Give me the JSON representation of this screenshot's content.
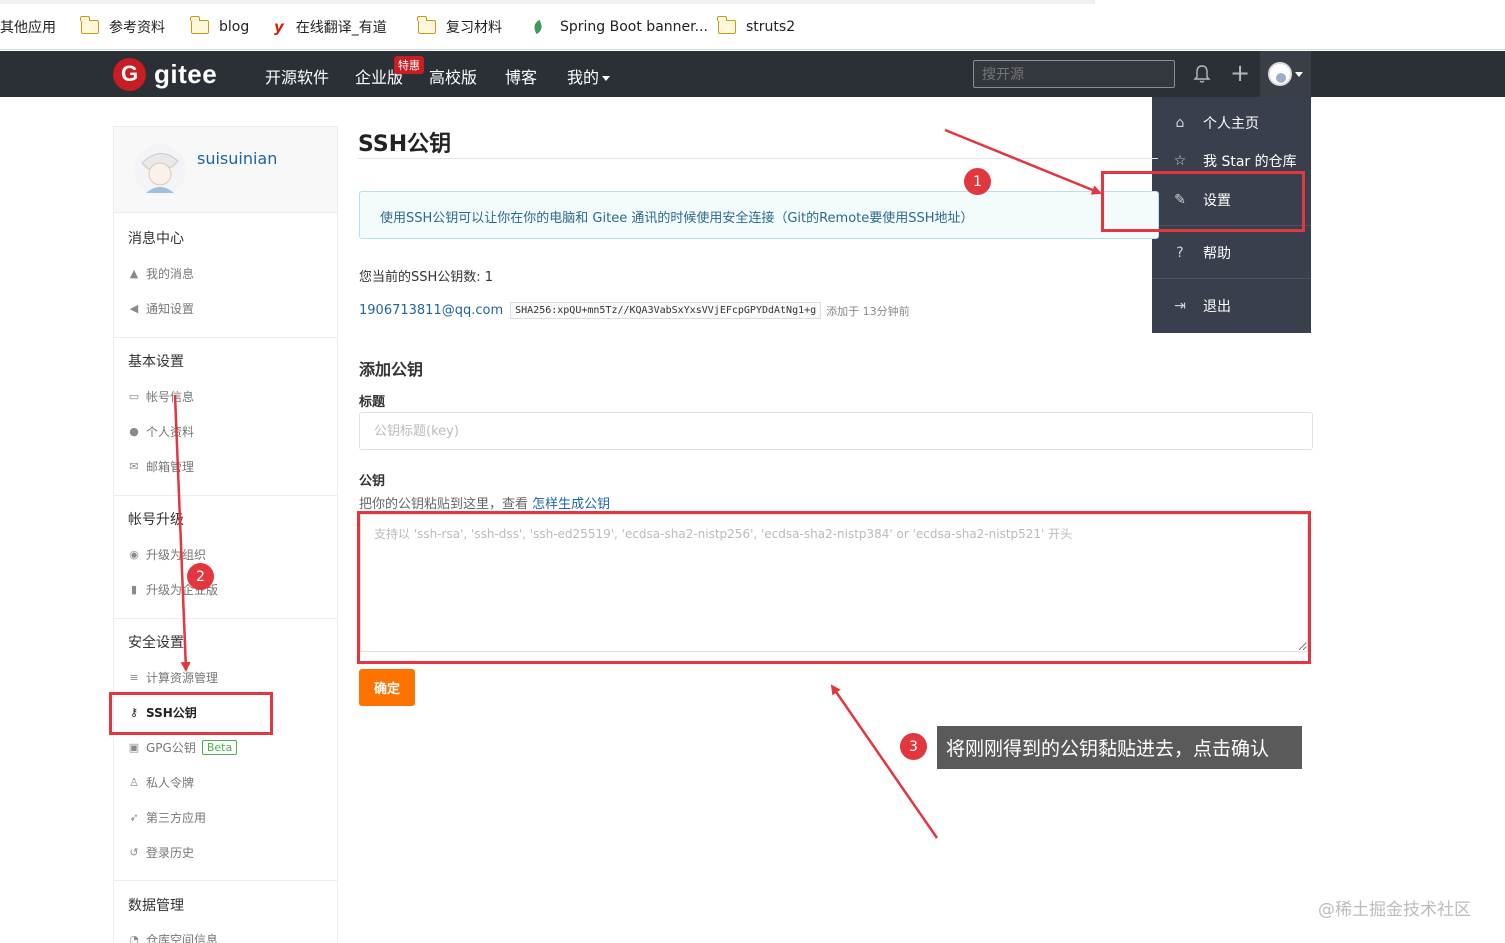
{
  "bookmarks": [
    {
      "label": "其他应用",
      "icon": "none"
    },
    {
      "label": "参考资料",
      "icon": "folder-icon"
    },
    {
      "label": "blog",
      "icon": "folder-icon"
    },
    {
      "label": "在线翻译_有道",
      "icon": "youdao-icon"
    },
    {
      "label": "复习材料",
      "icon": "folder-icon"
    },
    {
      "label": "Spring Boot banner...",
      "icon": "leaf-icon"
    },
    {
      "label": "struts2",
      "icon": "folder-icon"
    }
  ],
  "navbar": {
    "logo_mark": "G",
    "logo_text": "gitee",
    "links": [
      "开源软件",
      "企业版",
      "高校版",
      "博客",
      "我的"
    ],
    "enterprise_badge": "特惠",
    "search_placeholder": "搜开源",
    "plus_glyph": "+"
  },
  "dropdown": {
    "items": [
      {
        "label": "个人主页",
        "icon": "home-icon",
        "glyph": "⌂"
      },
      {
        "label": "我 Star 的仓库",
        "icon": "star-icon",
        "glyph": "☆"
      },
      {
        "label": "设置",
        "icon": "edit-icon",
        "glyph": "✎"
      },
      {
        "label": "帮助",
        "icon": "help-icon",
        "glyph": "?"
      },
      {
        "label": "退出",
        "icon": "logout-icon",
        "glyph": "⇥"
      }
    ]
  },
  "sidebar": {
    "username": "suisuinian",
    "sections": [
      {
        "title": "消息中心",
        "items": [
          {
            "label": "我的消息",
            "icon": "bell-icon",
            "glyph": "▲"
          },
          {
            "label": "通知设置",
            "icon": "volume-icon",
            "glyph": "◀"
          }
        ]
      },
      {
        "title": "基本设置",
        "items": [
          {
            "label": "帐号信息",
            "icon": "id-card-icon",
            "glyph": "▭"
          },
          {
            "label": "个人资料",
            "icon": "user-icon",
            "glyph": "●"
          },
          {
            "label": "邮箱管理",
            "icon": "mail-icon",
            "glyph": "✉"
          }
        ]
      },
      {
        "title": "帐号升级",
        "items": [
          {
            "label": "升级为组织",
            "icon": "group-icon",
            "glyph": "◉"
          },
          {
            "label": "升级为企业版",
            "icon": "bookmark-icon",
            "glyph": "▮"
          }
        ]
      },
      {
        "title": "安全设置",
        "items": [
          {
            "label": "计算资源管理",
            "icon": "list-icon",
            "glyph": "≡"
          },
          {
            "label": "SSH公钥",
            "icon": "key-icon",
            "glyph": "⚷"
          },
          {
            "label": "GPG公钥",
            "icon": "lock-icon",
            "glyph": "▣"
          },
          {
            "label": "私人令牌",
            "icon": "token-icon",
            "glyph": "♙"
          },
          {
            "label": "第三方应用",
            "icon": "rocket-icon",
            "glyph": "➶"
          },
          {
            "label": "登录历史",
            "icon": "history-icon",
            "glyph": "↺"
          }
        ]
      },
      {
        "title": "数据管理",
        "items": [
          {
            "label": "仓库空间信息",
            "icon": "pie-icon",
            "glyph": "◔"
          }
        ]
      }
    ],
    "beta_badge": "Beta"
  },
  "main": {
    "title": "SSH公钥",
    "info": "使用SSH公钥可以让你在你的电脑和 Gitee 通讯的时候使用安全连接（Git的Remote要使用SSH地址）",
    "count_text": "您当前的SSH公钥数: 1",
    "key": {
      "email": "1906713811@qq.com",
      "fingerprint": "SHA256:xpQU+mn5Tz//KQA3VabSxYxsVVjEFcpGPYDdAtNg1+g",
      "added": "添加于 13分钟前"
    },
    "add_heading": "添加公钥",
    "title_label": "标题",
    "title_placeholder": "公钥标题(key)",
    "key_label": "公钥",
    "hint_prefix": "把你的公钥粘贴到这里，查看",
    "hint_link": "怎样生成公钥",
    "key_placeholder": "支持以 'ssh-rsa', 'ssh-dss', 'ssh-ed25519', 'ecdsa-sha2-nistp256', 'ecdsa-sha2-nistp384' or 'ecdsa-sha2-nistp521' 开头",
    "submit": "确定"
  },
  "annotations": {
    "steps": [
      "1",
      "2",
      "3"
    ],
    "callout": "将刚刚得到的公钥黏贴进去，点击确认",
    "color": "#e2373f"
  },
  "watermark": "@稀土掘金技术社区"
}
